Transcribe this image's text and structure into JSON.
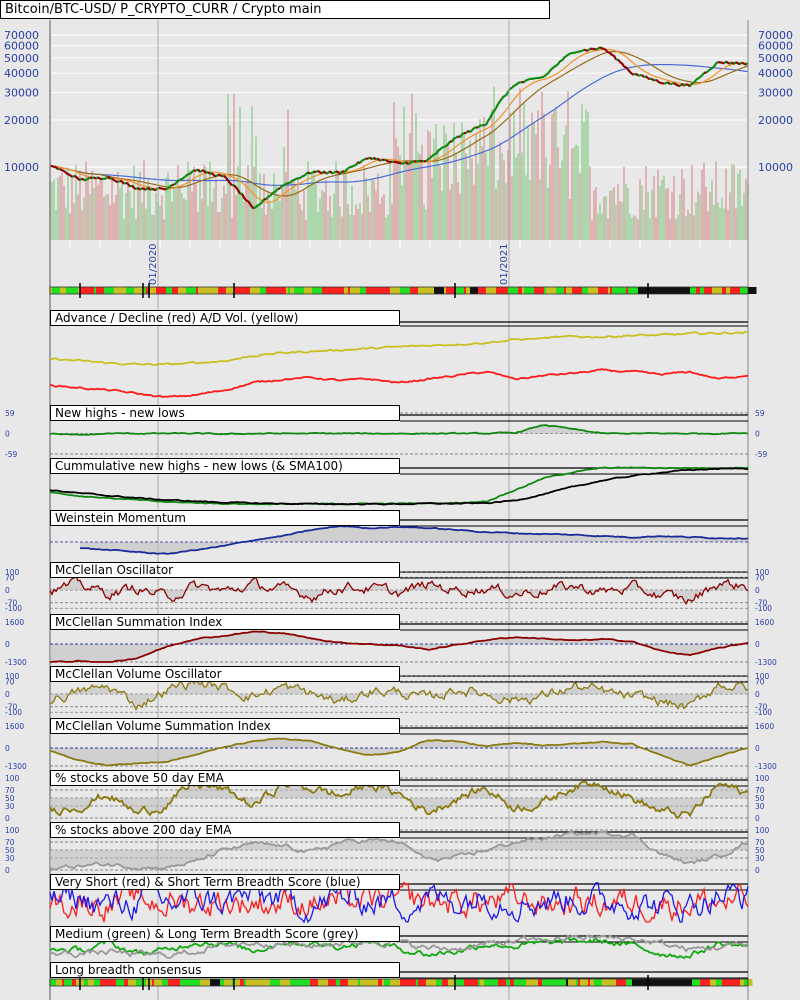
{
  "header": {
    "title": "Bitcoin/BTC-USD/ P_CRYPTO_CURR / Crypto main"
  },
  "colors": {
    "up": "#118811",
    "down": "#8b0000",
    "axis_text": "#2a3fa8",
    "volume_up": "#8fcf8f",
    "volume_down": "#d89a9a",
    "ma_fast": "#f0922a",
    "ma_mid": "#9a6a1a",
    "ma_slow": "#4a6ad8"
  },
  "chart_data": [
    {
      "type": "line",
      "name": "price",
      "title": "Bitcoin/BTC-USD/ P_CRYPTO_CURR / Crypto main",
      "yscale": "log",
      "ylim": [
        4000,
        80000
      ],
      "yticks": [
        "70000",
        "60000",
        "50000",
        "40000",
        "30000",
        "20000",
        "10000"
      ],
      "ytick_values": [
        70000,
        60000,
        50000,
        40000,
        30000,
        20000,
        10000
      ],
      "xlabels": [
        "01/2020",
        "01/2021"
      ],
      "x_months": [
        "09/2019",
        "10/2019",
        "11/2019",
        "12/2019",
        "01/2020",
        "02/2020",
        "03/2020",
        "04/2020",
        "05/2020",
        "06/2020",
        "07/2020",
        "08/2020",
        "09/2020",
        "10/2020",
        "11/2020",
        "12/2020",
        "01/2021",
        "02/2021",
        "03/2021",
        "04/2021",
        "05/2021",
        "06/2021",
        "07/2021",
        "08/2021",
        "09/2021"
      ],
      "close": [
        10300,
        8300,
        8600,
        7300,
        7200,
        9600,
        8600,
        5300,
        7600,
        9300,
        9200,
        11500,
        10500,
        11000,
        15500,
        19000,
        34000,
        38000,
        55000,
        58000,
        40000,
        35000,
        33000,
        47000,
        46000
      ],
      "series": [
        "price",
        "sma50",
        "sma100",
        "sma200",
        "volume"
      ]
    },
    {
      "name": "breadth-bar-top",
      "type": "heatmap",
      "palette": [
        "#ff2020",
        "#22dd22",
        "#c8c020",
        "#111111"
      ]
    },
    {
      "name": "advance-decline",
      "title": "Advance / Decline (red) A/D Vol. (yellow)",
      "type": "line",
      "ylim": [
        0,
        100
      ],
      "series": [
        {
          "name": "A/D Vol.",
          "color": "#c8c020",
          "points": [
            58,
            55,
            52,
            50,
            50,
            52,
            55,
            62,
            66,
            68,
            70,
            72,
            74,
            76,
            78,
            80,
            84,
            86,
            88,
            88,
            90,
            90,
            92,
            93,
            94
          ]
        },
        {
          "name": "Advance / Decline",
          "color": "#ff1a1a",
          "points": [
            22,
            18,
            15,
            10,
            5,
            8,
            15,
            25,
            30,
            32,
            28,
            30,
            25,
            30,
            35,
            40,
            30,
            35,
            38,
            42,
            40,
            36,
            40,
            30,
            36
          ]
        }
      ]
    },
    {
      "name": "new-highs-lows",
      "title": "New highs - new lows",
      "type": "line",
      "ylim": [
        -59,
        59
      ],
      "yticks": [
        "59",
        "0",
        "-59"
      ],
      "ytick_values": [
        59,
        0,
        -59
      ],
      "series": [
        {
          "name": "NH-NL",
          "color": "#118811",
          "points": [
            0,
            -5,
            0,
            0,
            0,
            0,
            -2,
            0,
            0,
            0,
            0,
            0,
            0,
            0,
            0,
            0,
            2,
            25,
            12,
            0,
            0,
            0,
            0,
            0,
            2
          ]
        }
      ]
    },
    {
      "name": "cumulative-nh-nl",
      "title": "Cummulative new highs - new lows (& SMA100)",
      "type": "line",
      "ylim": [
        0,
        100
      ],
      "series": [
        {
          "name": "Cum NH-NL",
          "color": "#118811",
          "points": [
            35,
            25,
            20,
            15,
            10,
            8,
            6,
            5,
            5,
            5,
            5,
            6,
            6,
            7,
            8,
            12,
            40,
            70,
            85,
            95,
            96,
            95,
            95,
            95,
            96
          ]
        },
        {
          "name": "SMA100",
          "color": "#000000",
          "points": [
            40,
            32,
            26,
            20,
            15,
            12,
            9,
            7,
            6,
            5,
            5,
            5,
            5,
            6,
            6,
            7,
            14,
            30,
            48,
            64,
            75,
            84,
            90,
            93,
            94
          ]
        }
      ]
    },
    {
      "name": "weinstein-momentum",
      "title": "Weinstein Momentum",
      "type": "line",
      "ylim": [
        -40,
        60
      ],
      "baseline": 0,
      "series": [
        {
          "name": "Momentum",
          "color": "#1a2a9a",
          "points": [
            null,
            -15,
            -20,
            -25,
            -30,
            -20,
            -10,
            5,
            15,
            30,
            40,
            35,
            38,
            35,
            30,
            25,
            22,
            20,
            18,
            15,
            12,
            15,
            12,
            10,
            10
          ]
        }
      ]
    },
    {
      "name": "mcclellan-oscillator",
      "title": "McClellan Oscillator",
      "type": "line",
      "ylim": [
        -110,
        110
      ],
      "yticks": [
        "100",
        "70",
        "0",
        "-70",
        "-100"
      ],
      "ytick_values": [
        100,
        70,
        0,
        -70,
        -100
      ],
      "noise": 45,
      "series": [
        {
          "name": "Oscillator",
          "color": "#8b0000",
          "points": [
            0,
            30,
            -20,
            10,
            -40,
            20,
            -10,
            30,
            0,
            -30,
            20,
            10,
            -20,
            30,
            0,
            10,
            -20,
            0,
            20,
            -10,
            10,
            -30,
            -60,
            40,
            20
          ]
        }
      ]
    },
    {
      "name": "mcclellan-summation",
      "title": "McClellan Summation Index",
      "type": "line",
      "ylim": [
        -1300,
        1600
      ],
      "yticks": [
        "1600",
        "0",
        "-1300"
      ],
      "ytick_values": [
        1600,
        0,
        -1300
      ],
      "baseline": 0,
      "series": [
        {
          "name": "Summation",
          "color": "#8b0000",
          "points": [
            -1300,
            -1250,
            -1350,
            -1000,
            -200,
            400,
            600,
            900,
            800,
            400,
            100,
            0,
            -100,
            -400,
            -50,
            300,
            500,
            400,
            250,
            350,
            200,
            -500,
            -800,
            -300,
            100
          ]
        }
      ]
    },
    {
      "name": "mcclellan-volume-oscillator",
      "title": "McClellan Volume Oscillator",
      "type": "line",
      "ylim": [
        -110,
        110
      ],
      "yticks": [
        "100",
        "70",
        "0",
        "-70",
        "-100"
      ],
      "ytick_values": [
        100,
        70,
        0,
        -70,
        -100
      ],
      "noise": 45,
      "series": [
        {
          "name": "Vol Oscillator",
          "color": "#8a7a10",
          "points": [
            -30,
            10,
            40,
            -60,
            20,
            70,
            30,
            -10,
            40,
            0,
            -50,
            20,
            10,
            -30,
            30,
            0,
            -30,
            -10,
            40,
            10,
            -20,
            -40,
            -80,
            60,
            30
          ]
        }
      ]
    },
    {
      "name": "mcclellan-volume-summation",
      "title": "McClellan Volume Summation Index",
      "type": "line",
      "ylim": [
        -1300,
        1600
      ],
      "yticks": [
        "1600",
        "0",
        "-1300"
      ],
      "ytick_values": [
        1600,
        0,
        -1300
      ],
      "baseline": 0,
      "series": [
        {
          "name": "Vol Summation",
          "color": "#8a7a10",
          "points": [
            -200,
            -900,
            -1250,
            -1100,
            -1000,
            -500,
            100,
            500,
            700,
            500,
            -100,
            -500,
            -300,
            600,
            500,
            100,
            400,
            200,
            300,
            450,
            300,
            -500,
            -1300,
            -600,
            0
          ]
        }
      ]
    },
    {
      "name": "pct-above-50ema",
      "title": "% stocks above 50 day EMA",
      "type": "line",
      "ylim": [
        0,
        100
      ],
      "yticks": [
        "100",
        "70",
        "50",
        "30",
        "0"
      ],
      "ytick_values": [
        100,
        70,
        50,
        30,
        0
      ],
      "noise": 18,
      "series": [
        {
          "name": "% above 50 EMA",
          "color": "#8a7a10",
          "points": [
            20,
            30,
            60,
            10,
            35,
            85,
            70,
            30,
            85,
            75,
            55,
            85,
            60,
            15,
            50,
            75,
            25,
            40,
            80,
            90,
            50,
            15,
            5,
            85,
            60
          ]
        }
      ]
    },
    {
      "name": "pct-above-200ema",
      "title": "% stocks above 200 day EMA",
      "type": "line",
      "ylim": [
        0,
        100
      ],
      "yticks": [
        "100",
        "70",
        "50",
        "30",
        "0"
      ],
      "ytick_values": [
        100,
        70,
        50,
        30,
        0
      ],
      "noise": 8,
      "series": [
        {
          "name": "% above 200 EMA",
          "color": "#999999",
          "points": [
            5,
            10,
            15,
            8,
            6,
            20,
            50,
            65,
            60,
            45,
            70,
            75,
            70,
            25,
            30,
            50,
            70,
            80,
            90,
            92,
            90,
            40,
            15,
            35,
            70
          ]
        }
      ]
    },
    {
      "name": "short-breadth-score",
      "title": "Very Short (red) & Short Term Breadth Score (blue)",
      "type": "line",
      "ylim": [
        0,
        100
      ],
      "noise": 55,
      "series": [
        {
          "name": "Very Short",
          "color": "#ff1a1a",
          "points": [
            50,
            50,
            50,
            50,
            50,
            50,
            50,
            50,
            50,
            50,
            50,
            50,
            50,
            50,
            50,
            50,
            50,
            50,
            50,
            50,
            50,
            50,
            50,
            50,
            50
          ]
        },
        {
          "name": "Short Term",
          "color": "#1a1aee",
          "points": [
            50,
            60,
            40,
            55,
            45,
            60,
            50,
            65,
            55,
            40,
            60,
            55,
            50,
            60,
            55,
            70,
            60,
            55,
            65,
            50,
            55,
            40,
            45,
            70,
            60
          ]
        }
      ]
    },
    {
      "name": "medium-long-breadth-score",
      "title": "Medium (green) & Long Term Breadth Score (grey)",
      "type": "line",
      "ylim": [
        0,
        100
      ],
      "noise": 20,
      "series": [
        {
          "name": "Medium",
          "color": "#11aa11",
          "points": [
            40,
            30,
            60,
            20,
            30,
            70,
            60,
            30,
            70,
            60,
            50,
            70,
            40,
            15,
            30,
            60,
            50,
            60,
            70,
            70,
            50,
            20,
            10,
            60,
            50
          ]
        },
        {
          "name": "Long Term",
          "color": "#999999",
          "points": [
            20,
            20,
            25,
            15,
            10,
            30,
            55,
            65,
            60,
            50,
            65,
            70,
            65,
            40,
            40,
            55,
            70,
            75,
            85,
            85,
            80,
            60,
            35,
            45,
            60
          ]
        }
      ]
    },
    {
      "name": "long-breadth-consensus",
      "title": "Long breadth consensus",
      "type": "heatmap",
      "palette": [
        "#ff2020",
        "#22dd22",
        "#c8c020",
        "#111111"
      ]
    }
  ]
}
